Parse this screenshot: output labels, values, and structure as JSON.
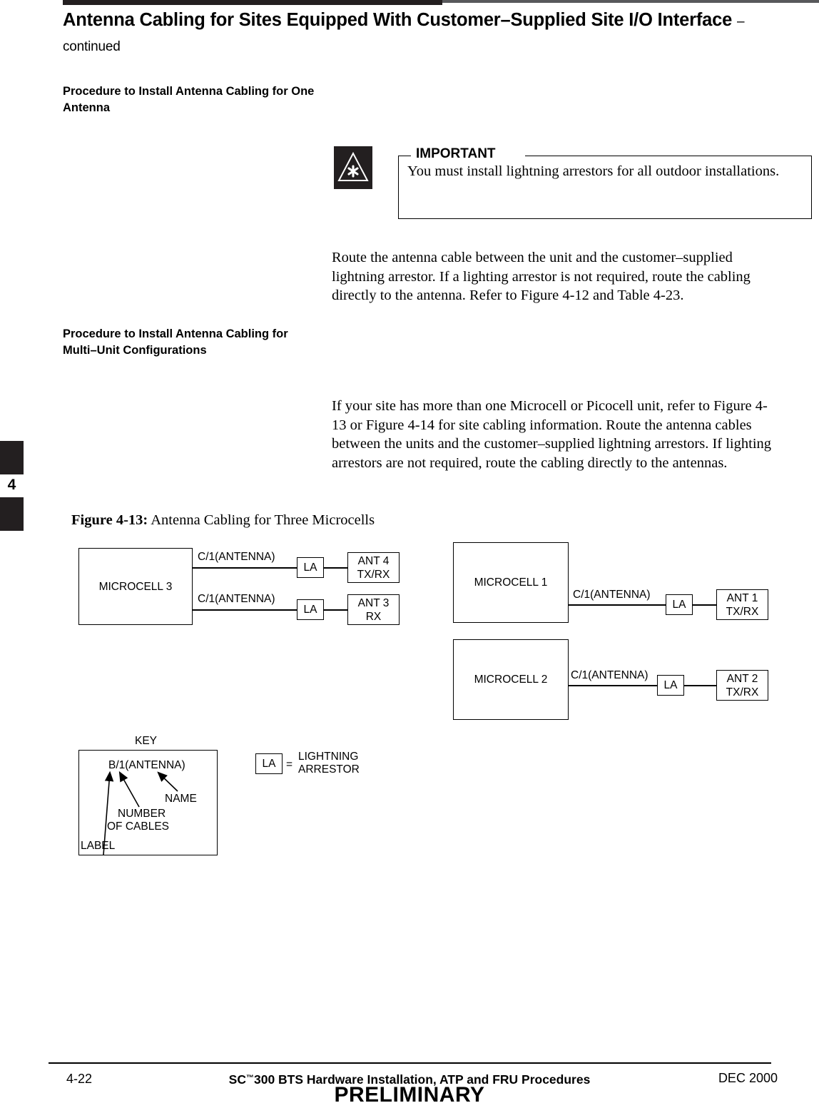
{
  "header": {
    "title_main": "Antenna Cabling for Sites Equipped With Customer–Supplied Site I/O Interface",
    "title_continued": "– continued"
  },
  "sections": [
    {
      "heading": "Procedure to Install Antenna Cabling for One Antenna"
    },
    {
      "heading": "Procedure to Install Antenna Cabling for Multi–Unit Configurations"
    }
  ],
  "callout": {
    "label": "IMPORTANT",
    "text": "You must install lightning arrestors for all outdoor installations.",
    "icon": "important-asterisk-triangle-icon"
  },
  "paragraphs": {
    "one_antenna": "Route the antenna cable between the unit and the customer–supplied lightning arrestor.  If a lighting arrestor is not required, route the cabling directly to the antenna.  Refer to Figure 4-12 and Table 4-23.",
    "multi_unit": "If your site has more than one Microcell or Picocell unit, refer to Figure 4-13 or Figure 4-14 for site cabling information.  Route the antenna cables between the units and the customer–supplied lightning arrestors.  If lighting arrestors are not required, route the cabling directly to the antennas."
  },
  "figure": {
    "number": "Figure 4-13:",
    "caption": "Antenna Cabling for Three Microcells",
    "units": [
      {
        "id": "microcell-3",
        "label": "MICROCELL 3"
      },
      {
        "id": "microcell-1",
        "label": "MICROCELL 1"
      },
      {
        "id": "microcell-2",
        "label": "MICROCELL 2"
      }
    ],
    "cable_labels": {
      "m3_top": "C/1(ANTENNA)",
      "m3_bottom": "C/1(ANTENNA)",
      "m1": "C/1(ANTENNA)",
      "m2": "C/1(ANTENNA)"
    },
    "arrestor_label": "LA",
    "antennas": [
      {
        "id": "ant-4",
        "name": "ANT 4",
        "mode": "TX/RX"
      },
      {
        "id": "ant-3",
        "name": "ANT 3",
        "mode": "RX"
      },
      {
        "id": "ant-1",
        "name": "ANT 1",
        "mode": "TX/RX"
      },
      {
        "id": "ant-2",
        "name": "ANT 2",
        "mode": "TX/RX"
      }
    ],
    "key": {
      "title": "KEY",
      "sample": "B/1(ANTENNA)",
      "callouts": {
        "name": "NAME",
        "number_of_cables_line1": "NUMBER",
        "number_of_cables_line2": "OF CABLES",
        "label": "LABEL"
      },
      "legend": {
        "symbol": "LA",
        "equals": "=",
        "meaning_line1": "LIGHTNING",
        "meaning_line2": "ARRESTOR"
      }
    }
  },
  "tab": {
    "chapter": "4"
  },
  "footer": {
    "page_number": "4-22",
    "title_pre": "SC",
    "title_tm": "™",
    "title_post": "300 BTS Hardware Installation, ATP and FRU Procedures",
    "date": "DEC 2000",
    "status": "PRELIMINARY"
  }
}
